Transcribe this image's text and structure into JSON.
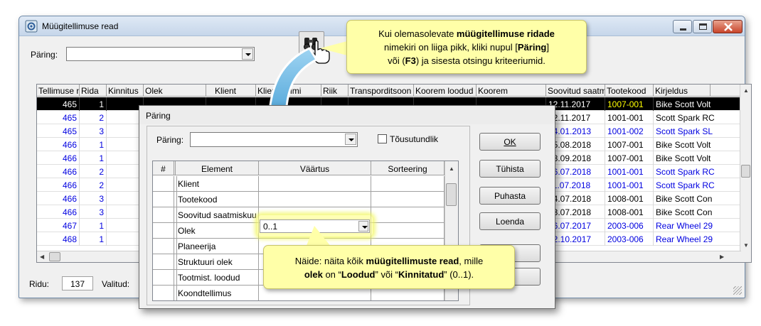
{
  "window": {
    "title": "Müügitellimuse read"
  },
  "toolbar": {
    "query_label": "Päring:"
  },
  "grid": {
    "columns": [
      "Tellimuse n",
      "Rida",
      "Kinnitus",
      "Olek",
      "Klient",
      "Kliendi nimi",
      "Riik",
      "Transporditsoon",
      "Koorem loodud",
      "Koorem",
      "Soovitud saatm",
      "Tootekood",
      "Kirjeldus"
    ],
    "rows": [
      {
        "order": "465",
        "line": "1",
        "date": "12.11.2017",
        "code": "1007-001",
        "desc": "Bike Scott Volt"
      },
      {
        "order": "465",
        "line": "2",
        "date": "22.11.2017",
        "code": "1001-001",
        "desc": "Scott Spark RC"
      },
      {
        "order": "465",
        "line": "3",
        "date": "14.01.2013",
        "code": "1001-002",
        "desc": "Scott Spark SL"
      },
      {
        "order": "466",
        "line": "1",
        "date": "15.08.2018",
        "code": "1007-001",
        "desc": "Bike Scott Volt"
      },
      {
        "order": "466",
        "line": "1",
        "date": "18.09.2018",
        "code": "1007-001",
        "desc": "Bike Scott Volt"
      },
      {
        "order": "466",
        "line": "2",
        "date": "16.07.2018",
        "code": "1001-001",
        "desc": "Scott Spark RC"
      },
      {
        "order": "466",
        "line": "2",
        "date": "11.07.2018",
        "code": "1001-001",
        "desc": "Scott Spark RC"
      },
      {
        "order": "466",
        "line": "3",
        "date": "14.07.2018",
        "code": "1008-001",
        "desc": "Bike Scott Con"
      },
      {
        "order": "466",
        "line": "3",
        "date": "13.07.2018",
        "code": "1008-001",
        "desc": "Bike Scott Con"
      },
      {
        "order": "467",
        "line": "1",
        "date": "16.07.2017",
        "code": "2003-006",
        "desc": "Rear Wheel 29"
      },
      {
        "order": "468",
        "line": "1",
        "date": "12.10.2017",
        "code": "2003-006",
        "desc": "Rear Wheel 29"
      }
    ]
  },
  "status": {
    "rows_label": "Ridu:",
    "rows_count": "137",
    "selected_label": "Valitud:"
  },
  "dialog": {
    "title": "Päring",
    "query_label": "Päring:",
    "ascending_label": "Tõusutundlik",
    "table_headers": [
      "#",
      "Element",
      "Väärtus",
      "Sorteering"
    ],
    "elements": [
      "Klient",
      "Tootekood",
      "Soovitud saatmiskuu",
      "Olek",
      "Planeerija",
      "Struktuuri olek",
      "Tootmist. loodud",
      "Koondtellimus"
    ],
    "olek_value": "0..1",
    "buttons": {
      "ok": "OK",
      "cancel": "Tühista",
      "clear": "Puhasta",
      "count": "Loenda",
      "more": "...",
      "hidden": ""
    }
  },
  "callouts": {
    "top_line1_pre": "Kui olemasolevate ",
    "top_line1_bold": "müügitellimuse ridade",
    "top_line2_pre": "nimekiri on liiga pikk, kliki nupul [",
    "top_line2_bold": "Päring",
    "top_line2_post": "]",
    "top_line3_pre": "või (",
    "top_line3_bold": "F3",
    "top_line3_post": ") ja sisesta otsingu kriteeriumid.",
    "bottom_line1_pre": "Näide: näita kõik ",
    "bottom_line1_bold": "müügitellimuste read",
    "bottom_line1_post": ", mille",
    "bottom_line2_bold1": "olek",
    "bottom_line2_mid1": " on “",
    "bottom_line2_bold2": "Loodud",
    "bottom_line2_mid2": "” või “",
    "bottom_line2_bold3": "Kinnitatud",
    "bottom_line2_post": "” (0..1)."
  },
  "colors": {
    "link_blue": "#0000e0",
    "callout_bg": "#ffffa8",
    "selected_code": "#ffff00"
  },
  "icons": [
    "app-icon",
    "binoculars-icon",
    "hand-cursor-icon",
    "arrow-icon",
    "minimize-icon",
    "maximize-icon",
    "close-icon"
  ]
}
